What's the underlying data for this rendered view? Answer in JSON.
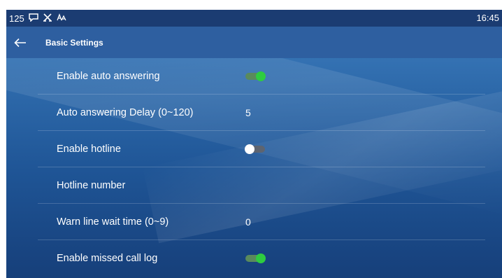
{
  "status_bar": {
    "account_number": "125",
    "time": "16:45",
    "icons": [
      "message-icon",
      "network-icon",
      "font-icon"
    ]
  },
  "header": {
    "back_icon": "←",
    "title": "Basic Settings"
  },
  "settings": {
    "items": [
      {
        "label": "Enable auto answering",
        "type": "toggle",
        "enabled": true
      },
      {
        "label": "Auto answering Delay (0~120)",
        "type": "value",
        "value": "5"
      },
      {
        "label": "Enable hotline",
        "type": "toggle",
        "enabled": false
      },
      {
        "label": "Hotline number",
        "type": "value",
        "value": ""
      },
      {
        "label": "Warn line wait time (0~9)",
        "type": "value",
        "value": "0"
      },
      {
        "label": "Enable missed call log",
        "type": "toggle",
        "enabled": true
      }
    ]
  },
  "colors": {
    "status_bar_bg": "#1b3c72",
    "title_bar_bg": "#2e5fa0",
    "toggle_on": "#2ecc40",
    "toggle_off_knob": "#ffffff"
  }
}
